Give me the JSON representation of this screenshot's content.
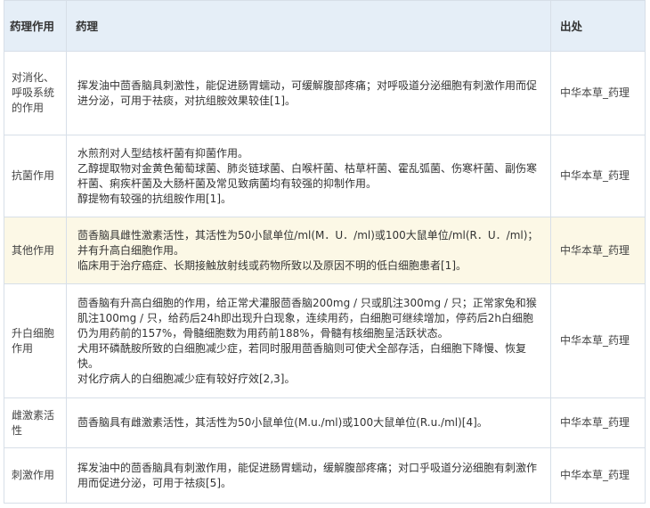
{
  "table": {
    "headers": [
      "药理作用",
      "药理",
      "出处"
    ],
    "rows": [
      {
        "category": "对消化、呼吸系统的作用",
        "lines": [
          "挥发油中茴香脑具刺激性，能促进肠胃蠕动，可缓解腹部疼痛；对呼吸道分泌细胞有刺激作用而促进分泌，可用于祛痰，对抗组胺效果较佳[1]。"
        ],
        "source": "中华本草_药理"
      },
      {
        "category": "抗菌作用",
        "lines": [
          "水煎剂对人型结核杆菌有抑菌作用。",
          "乙醇提取物对金黄色葡萄球菌、肺炎链球菌、白喉杆菌、枯草杆菌、霍乱弧菌、伤寒杆菌、副伤寒杆菌、痢疾杆菌及大肠杆菌及常见致病菌均有较强的抑制作用。",
          "醇提物有较强的抗组胺作用[1]。"
        ],
        "source": "中华本草_药理"
      },
      {
        "category": "其他作用",
        "lines": [
          "茴香脑具雌性激素活性，其活性为50小鼠单位/ml(M．U．/ml)或100大鼠单位/ml(R．U．/ml)；并有升高白细胞作用。",
          "临床用于治疗癌症、长期接触放射线或药物所致以及原因不明的低白细胞患者[1]。"
        ],
        "source": "中华本草_药理"
      },
      {
        "category": "升白细胞作用",
        "lines": [
          "茴香脑有升高白细胞的作用，给正常犬灌服茴香脑200mg / 只或肌注300mg / 只；正常家兔和猴肌注100mg / 只，给药后24h即出现升白现象，连续用药，白细胞可继续增加，停药后2h白细胞仍为用药前的157%，骨髓细胞数为用药前188%，骨髓有核细胞呈活跃状态。",
          "犬用环磷酰胺所致的白细胞减少症，若同时服用茴香脑则可使犬全部存活，白细胞下降慢、恢复快。",
          "对化疗病人的白细胞减少症有较好疗效[2,3]。"
        ],
        "source": "中华本草_药理"
      },
      {
        "category": "雌激素活性",
        "lines": [
          "茴香脑具有雌激素活性，其活性为50小鼠单位(M.u./ml)或100大鼠单位(R.u./ml)[4]。"
        ],
        "source": "中华本草_药理"
      },
      {
        "category": "刺激作用",
        "lines": [
          "挥发油中的茴香脑具有刺激作用，能促进肠胃蠕动，缓解腹部疼痛；对口乎吸道分泌细胞有刺激作用而促进分泌，可用于祛痰[5]。"
        ],
        "source": "中华本草_药理"
      }
    ]
  }
}
